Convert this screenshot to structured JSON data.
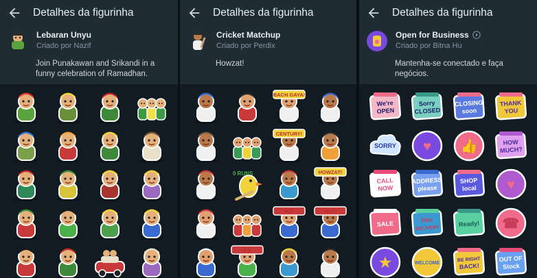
{
  "panels": [
    {
      "screen_title": "Detalhes da figurinha",
      "pack": {
        "name": "Lebaran Unyu",
        "author": "Criado por Nazif",
        "description": "Join Punakawan and Srikandi in a funny celebration of Ramadhan.",
        "thumb_icon": "lebaran-character-icon"
      },
      "stickers": [
        {
          "kind": "char",
          "name": "sticker-lebaran-1",
          "skin": "#e6b07a",
          "cloth": "#5aa33c",
          "accent": "#e23b2b",
          "text": ""
        },
        {
          "kind": "char",
          "name": "sticker-lebaran-2",
          "skin": "#e6b07a",
          "cloth": "#6a8f3a",
          "accent": "#f0d23b",
          "text": ""
        },
        {
          "kind": "char",
          "name": "sticker-lebaran-3",
          "skin": "#e6b07a",
          "cloth": "#3f8a3a",
          "accent": "#c0282a",
          "text": ""
        },
        {
          "kind": "group",
          "name": "sticker-lebaran-4",
          "skin": "#e6b07a",
          "cloth": "#3f9a46",
          "accent": "#f2e04c",
          "text": ""
        },
        {
          "kind": "char",
          "name": "sticker-lebaran-5",
          "skin": "#e6b07a",
          "cloth": "#7aa04a",
          "accent": "#3a7bd5",
          "text": ""
        },
        {
          "kind": "char",
          "name": "sticker-lebaran-6",
          "skin": "#e6b07a",
          "cloth": "#c83a3a",
          "accent": "#f0a03b",
          "text": ""
        },
        {
          "kind": "char",
          "name": "sticker-lebaran-7",
          "skin": "#e6b07a",
          "cloth": "#3f8a3a",
          "accent": "#f0d23b",
          "text": ""
        },
        {
          "kind": "char",
          "name": "sticker-lebaran-8",
          "skin": "#e6b07a",
          "cloth": "#e8e0c8",
          "accent": "#7a5a3a",
          "text": ""
        },
        {
          "kind": "char",
          "name": "sticker-lebaran-9",
          "skin": "#e6b07a",
          "cloth": "#2f8a5a",
          "accent": "#c0282a",
          "text": ""
        },
        {
          "kind": "char",
          "name": "sticker-lebaran-10",
          "skin": "#e6b07a",
          "cloth": "#d8c43a",
          "accent": "#3f8a3a",
          "text": ""
        },
        {
          "kind": "char",
          "name": "sticker-lebaran-11",
          "skin": "#e6b07a",
          "cloth": "#a8342f",
          "accent": "#f0d23b",
          "text": ""
        },
        {
          "kind": "char",
          "name": "sticker-lebaran-12",
          "skin": "#e6b07a",
          "cloth": "#9a6ac0",
          "accent": "#f0d23b",
          "text": ""
        },
        {
          "kind": "char",
          "name": "sticker-lebaran-13",
          "skin": "#e6b07a",
          "cloth": "#c83a3a",
          "accent": "#3f8a3a",
          "text": ""
        },
        {
          "kind": "char",
          "name": "sticker-lebaran-14",
          "skin": "#e6b07a",
          "cloth": "#4ab04a",
          "accent": "#1a1a1a",
          "text": ""
        },
        {
          "kind": "char",
          "name": "sticker-lebaran-15",
          "skin": "#e6b07a",
          "cloth": "#4aa04a",
          "accent": "#f0d23b",
          "text": ""
        },
        {
          "kind": "char",
          "name": "sticker-lebaran-16",
          "skin": "#e6b07a",
          "cloth": "#3a6ad0",
          "accent": "#f0d23b",
          "text": ""
        },
        {
          "kind": "char",
          "name": "sticker-lebaran-17",
          "skin": "#e6b07a",
          "cloth": "#c83a3a",
          "accent": "#1a1a1a",
          "text": ""
        },
        {
          "kind": "char",
          "name": "sticker-lebaran-18",
          "skin": "#e6b07a",
          "cloth": "#3f8a3a",
          "accent": "#c0282a",
          "text": ""
        },
        {
          "kind": "car",
          "name": "sticker-lebaran-19",
          "skin": "#e6b07a",
          "cloth": "#c83a3a",
          "accent": "#e8e0c8",
          "text": ""
        },
        {
          "kind": "char",
          "name": "sticker-lebaran-20",
          "skin": "#e6b07a",
          "cloth": "#9a6ac0",
          "accent": "#e8e0c8",
          "text": ""
        }
      ]
    },
    {
      "screen_title": "Detalhes da figurinha",
      "pack": {
        "name": "Cricket Matchup",
        "author": "Criado por Perdix",
        "description": "Howzat!",
        "thumb_icon": "cricket-player-icon"
      },
      "stickers": [
        {
          "kind": "char",
          "name": "sticker-cricket-1",
          "skin": "#b9794a",
          "cloth": "#f0f0f0",
          "accent": "#2a6ad0",
          "text": ""
        },
        {
          "kind": "char",
          "name": "sticker-cricket-2",
          "skin": "#e0a070",
          "cloth": "#c83a3a",
          "accent": "#2a2a2a",
          "text": ""
        },
        {
          "kind": "text",
          "name": "sticker-cricket-3",
          "skin": "#e0a070",
          "cloth": "#f0f0f0",
          "accent": "#f0d23b",
          "text": "BACH GAYA!"
        },
        {
          "kind": "char",
          "name": "sticker-cricket-4",
          "skin": "#b9794a",
          "cloth": "#f0f0f0",
          "accent": "#3a6ad0",
          "text": ""
        },
        {
          "kind": "char",
          "name": "sticker-cricket-5",
          "skin": "#b9794a",
          "cloth": "#f0f0f0",
          "accent": "#7a5a3a",
          "text": ""
        },
        {
          "kind": "group",
          "name": "sticker-cricket-6",
          "skin": "#e0a070",
          "cloth": "#3a9a5a",
          "accent": "#f0d23b",
          "text": ""
        },
        {
          "kind": "text",
          "name": "sticker-cricket-7",
          "skin": "#b9794a",
          "cloth": "#f0f0f0",
          "accent": "#f0d23b",
          "text": "CENTURY!"
        },
        {
          "kind": "char",
          "name": "sticker-cricket-8",
          "skin": "#b9794a",
          "cloth": "#f0a03b",
          "accent": "#2a2a2a",
          "text": ""
        },
        {
          "kind": "char",
          "name": "sticker-cricket-9",
          "skin": "#b9794a",
          "cloth": "#f0f0f0",
          "accent": "#c83a3a",
          "text": ""
        },
        {
          "kind": "bird",
          "name": "sticker-cricket-10",
          "skin": "#f0d23b",
          "cloth": "#4ab04a",
          "accent": "#f08a3b",
          "text": "0 RUNS"
        },
        {
          "kind": "char",
          "name": "sticker-cricket-11",
          "skin": "#b9794a",
          "cloth": "#3a9ad0",
          "accent": "#c83a3a",
          "text": ""
        },
        {
          "kind": "text",
          "name": "sticker-cricket-12",
          "skin": "#b9794a",
          "cloth": "#f0f0f0",
          "accent": "#f0d23b",
          "text": "HOWZAT!"
        },
        {
          "kind": "char",
          "name": "sticker-cricket-13",
          "skin": "#e0a070",
          "cloth": "#f0f0f0",
          "accent": "#c83a3a",
          "text": ""
        },
        {
          "kind": "group",
          "name": "sticker-cricket-14",
          "skin": "#e0a070",
          "cloth": "#c83a3a",
          "accent": "#f0a03b",
          "text": ""
        },
        {
          "kind": "text",
          "name": "sticker-cricket-15",
          "skin": "#e0a070",
          "cloth": "#3a6ad0",
          "accent": "#c83a3a",
          "text": "NO!"
        },
        {
          "kind": "text",
          "name": "sticker-cricket-16",
          "skin": "#b9794a",
          "cloth": "#3a6ad0",
          "accent": "#c83a3a",
          "text": "OUT!"
        },
        {
          "kind": "char",
          "name": "sticker-cricket-17",
          "skin": "#e0a070",
          "cloth": "#3a6ad0",
          "accent": "#f0f0f0",
          "text": ""
        },
        {
          "kind": "text",
          "name": "sticker-cricket-18",
          "skin": "#e0a070",
          "cloth": "#4ab04a",
          "accent": "#c83a3a",
          "text": "6 6"
        },
        {
          "kind": "char",
          "name": "sticker-cricket-19",
          "skin": "#b9794a",
          "cloth": "#3a9ad0",
          "accent": "#f0d23b",
          "text": ""
        },
        {
          "kind": "char",
          "name": "sticker-cricket-20",
          "skin": "#b9794a",
          "cloth": "#f0f0f0",
          "accent": "#2a2a2a",
          "text": ""
        }
      ]
    },
    {
      "screen_title": "Detalhes da figurinha",
      "pack": {
        "name": "Open for Business",
        "author": "Criado por Bitna Hu",
        "description": "Mantenha-se conectado e faça negócios.",
        "thumb_icon": "open-business-icon",
        "animated_badge_icon": "play-circle-icon"
      },
      "stickers": [
        {
          "kind": "sign",
          "name": "sticker-business-1",
          "skin": "#f6b7c6",
          "cloth": "#f06a8a",
          "accent": "#1a1a6a",
          "text": "We're OPEN"
        },
        {
          "kind": "sign",
          "name": "sticker-business-2",
          "skin": "#7ad0c0",
          "cloth": "#3a9a8a",
          "accent": "#1a1a6a",
          "text": "Sorry CLOSED"
        },
        {
          "kind": "sign",
          "name": "sticker-business-3",
          "skin": "#5a7ae0",
          "cloth": "#f06a8a",
          "accent": "#ffffff",
          "text": "CLOSING soon"
        },
        {
          "kind": "sign",
          "name": "sticker-business-4",
          "skin": "#f0c83a",
          "cloth": "#f06a8a",
          "accent": "#4a2aa0",
          "text": "THANK YOU"
        },
        {
          "kind": "cloud",
          "name": "sticker-business-5",
          "skin": "#cfe6ff",
          "cloth": "#8aa8e0",
          "accent": "#2a3aa0",
          "text": "SORRY"
        },
        {
          "kind": "round",
          "name": "sticker-business-6",
          "skin": "#7a4ae0",
          "cloth": "#f06a8a",
          "accent": "#ffffff",
          "text": "♥"
        },
        {
          "kind": "round",
          "name": "sticker-business-7",
          "skin": "#f06a8a",
          "cloth": "#f0c83a",
          "accent": "#ffffff",
          "text": "👍"
        },
        {
          "kind": "sign",
          "name": "sticker-business-8",
          "skin": "#e0a0f0",
          "cloth": "#b05ad0",
          "accent": "#4a2aa0",
          "text": "HOW MUCH?"
        },
        {
          "kind": "sign",
          "name": "sticker-business-9",
          "skin": "#ffffff",
          "cloth": "#e84a7a",
          "accent": "#e84a7a",
          "text": "CALL NOW"
        },
        {
          "kind": "sign",
          "name": "sticker-business-10",
          "skin": "#7aa0f0",
          "cloth": "#3a6ad0",
          "accent": "#ffffff",
          "text": "ADDRESS please"
        },
        {
          "kind": "sign",
          "name": "sticker-business-11",
          "skin": "#5a5ae0",
          "cloth": "#f06a8a",
          "accent": "#ffffff",
          "text": "SHOP local"
        },
        {
          "kind": "round",
          "name": "sticker-business-12",
          "skin": "#b05ad0",
          "cloth": "#f06a8a",
          "accent": "#ffffff",
          "text": "♥"
        },
        {
          "kind": "sign",
          "name": "sticker-business-13",
          "skin": "#f06a8a",
          "cloth": "#ffffff",
          "accent": "#ffffff",
          "text": "SALE"
        },
        {
          "kind": "sign",
          "name": "sticker-business-14",
          "skin": "#3a9ad0",
          "cloth": "#5ad0a0",
          "accent": "#c83a5a",
          "text": "free DELIVERY"
        },
        {
          "kind": "sign",
          "name": "sticker-business-15",
          "skin": "#5ad0a0",
          "cloth": "#3a9a8a",
          "accent": "#1a5a5a",
          "text": "Ready!"
        },
        {
          "kind": "round",
          "name": "sticker-business-16",
          "skin": "#f06a8a",
          "cloth": "#c83a5a",
          "accent": "#ffffff",
          "text": "☎"
        },
        {
          "kind": "round",
          "name": "sticker-business-17",
          "skin": "#7a4ae0",
          "cloth": "#f0c83a",
          "accent": "#ffffff",
          "text": "★"
        },
        {
          "kind": "round",
          "name": "sticker-business-18",
          "skin": "#f0c83a",
          "cloth": "#3a6ad0",
          "accent": "#3a6ad0",
          "text": "WELCOME"
        },
        {
          "kind": "sign",
          "name": "sticker-business-19",
          "skin": "#f0c83a",
          "cloth": "#f06a8a",
          "accent": "#4a2aa0",
          "text": "BE RIGHT BACK!"
        },
        {
          "kind": "sign",
          "name": "sticker-business-20",
          "skin": "#6aa0f0",
          "cloth": "#e84a7a",
          "accent": "#ffffff",
          "text": "OUT OF Stock"
        }
      ]
    }
  ],
  "colors": {
    "header_bg": "#1f2c34",
    "body_bg": "#121b22",
    "title_text": "#e9edef",
    "secondary_text": "#8696a0"
  }
}
